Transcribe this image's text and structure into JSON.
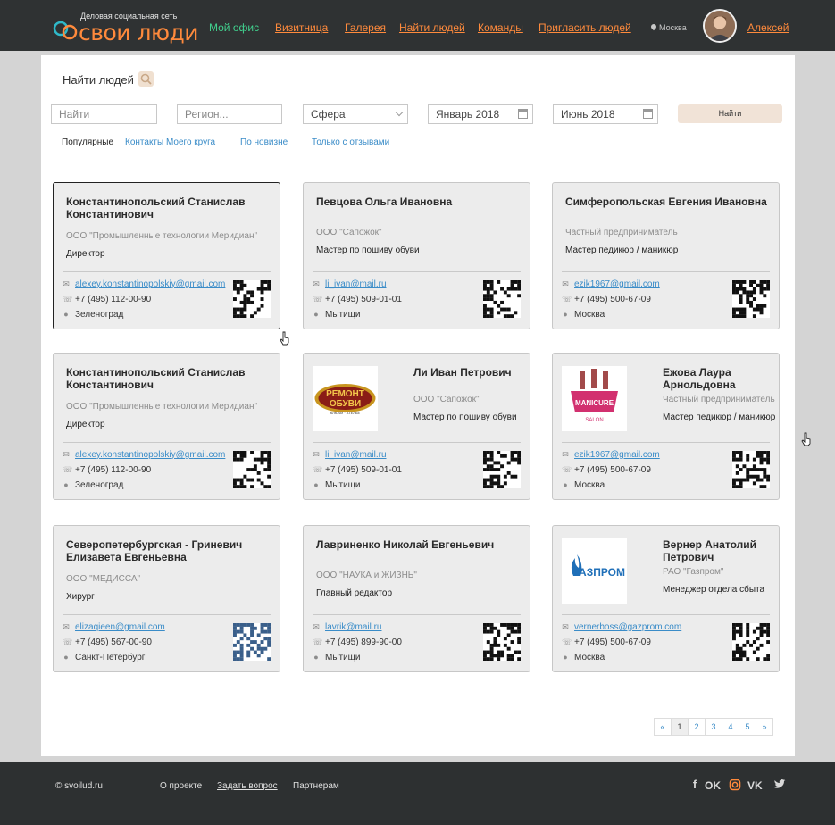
{
  "header": {
    "logo_tagline": "Деловая социальная сеть",
    "logo_name": "свои люди",
    "nav": [
      "Мой офис",
      "Визитница",
      "Галерея",
      "Найти людей",
      "Команды",
      "Пригласить людей"
    ],
    "city": "Москва",
    "user_name": "Алексей",
    "colors": {
      "accent": "#ff8a3c",
      "active": "#41d08e",
      "bar": "#2f3233"
    }
  },
  "search": {
    "title": "Найти людей",
    "query_placeholder": "Найти",
    "region_placeholder": "Регион...",
    "sphere_value": "Сфера",
    "date_from": "Январь 2018",
    "date_to": "Июнь 2018",
    "submit_label": "Найти"
  },
  "filters": {
    "current": "Популярные",
    "links": [
      "Контакты Моего  круга",
      "По новизне",
      "Только с отзывами"
    ]
  },
  "cards": [
    {
      "name": "Константинопольский Станислав Константинович",
      "org": "ООО \"Промышленные технологии Меридиан\"",
      "position": "Директор",
      "email": "alexey.konstantinopolskiy@gmail.com",
      "phone": "+7 (495) 112-00-90",
      "city": "Зеленоград"
    },
    {
      "name": "Певцова Ольга Ивановна",
      "org": "ООО \"Сапожок\"",
      "position": "Мастер по пошиву обуви",
      "email": "li_ivan@mail.ru",
      "phone": "+7 (495) 509-01-01",
      "city": "Мытищи"
    },
    {
      "name": "Симферопольская Евгения Ивановна",
      "org": "Частный предприниматель",
      "position": "Мастер педикюр / маникюр",
      "email": "ezik1967@gmail.com",
      "phone": "+7 (495) 500-67-09",
      "city": "Москва"
    },
    {
      "name": "Константинопольский Станислав Константинович",
      "org": "ООО \"Промышленные технологии Меридиан\"",
      "position": "Директор",
      "email": "alexey.konstantinopolskiy@gmail.com",
      "phone": "+7 (495) 112-00-90",
      "city": "Зеленоград"
    },
    {
      "name": "Ли Иван Петрович",
      "org": "ООО \"Сапожок\"",
      "position": "Мастер по пошиву обуви",
      "email": "li_ivan@mail.ru",
      "phone": "+7 (495) 509-01-01",
      "city": "Мытищи",
      "logo_lines": [
        "РЕМОНТ",
        "ОБУВИ",
        "КЛЮЧИ · АТЕЛЬЕ"
      ]
    },
    {
      "name": "Ежова Лаура Арнольдовна",
      "org": "Частный предприниматель",
      "position": "Мастер педикюр / маникюр",
      "email": "ezik1967@gmail.com",
      "phone": "+7 (495) 500-67-09",
      "city": "Москва",
      "logo_lines": [
        "MANICURE",
        "SALON"
      ]
    },
    {
      "name": "Северопетербургская - Гриневич Елизавета Евгеньевна",
      "org": "ООО \"МЕДИССА\"",
      "position": "Хирург",
      "email": "elizaqieen@gmail.com",
      "phone": "+7 (495) 567-00-90",
      "city": "Санкт-Петербург"
    },
    {
      "name": "Лавриненко Николай Евгеньевич",
      "org": "ООО \"НАУКА и ЖИЗНЬ\"",
      "position": "Главный редактор",
      "email": "lavrik@mail.ru",
      "phone": "+7 (495) 899-90-00",
      "city": "Мытищи"
    },
    {
      "name": "Вернер Анатолий Петрович",
      "org": "РАО \"Газпром\"",
      "position": "Менеджер отдела сбыта",
      "email": "vernerboss@gazprom.com",
      "phone": "+7 (495) 500-67-09",
      "city": "Москва",
      "logo_lines": [
        "ГАЗПРОМ"
      ]
    }
  ],
  "pagination": {
    "prev": "«",
    "pages": [
      "1",
      "2",
      "3",
      "4",
      "5"
    ],
    "current": "1",
    "next": "»"
  },
  "footer": {
    "copyright": "© svoilud.ru",
    "links": [
      "О проекте",
      "Задать вопрос",
      "Партнерам"
    ],
    "social_icons": [
      "facebook-icon",
      "odnoklassniki-icon",
      "instagram-icon",
      "vk-icon",
      "twitter-icon"
    ]
  }
}
